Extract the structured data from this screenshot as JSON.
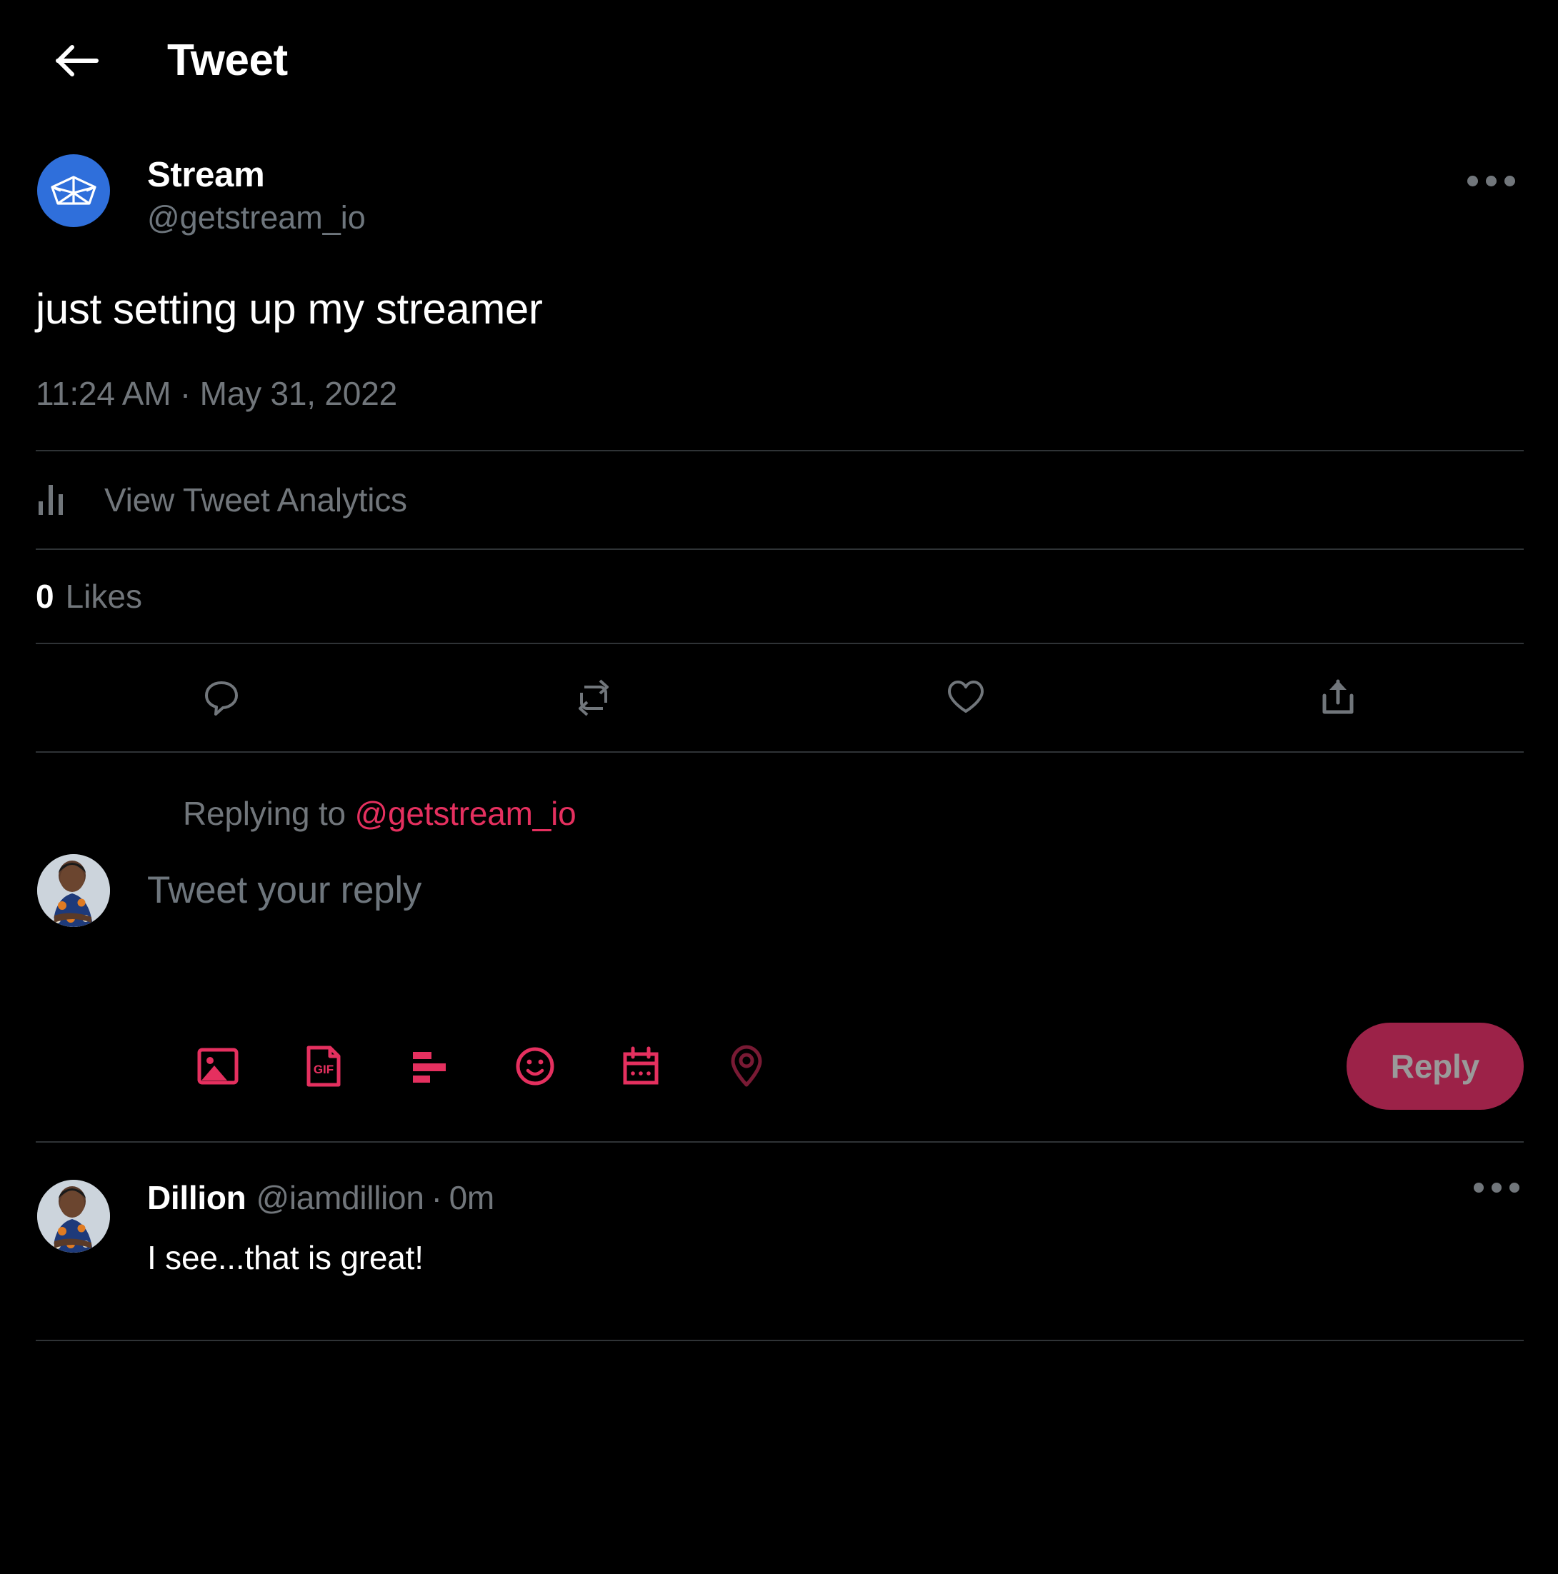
{
  "header": {
    "back_icon": "arrow-left-icon",
    "title": "Tweet"
  },
  "tweet": {
    "author": {
      "display_name": "Stream",
      "handle": "@getstream_io",
      "avatar": "stream-paper-boat-logo",
      "avatar_bg": "#2f6fdb"
    },
    "more_icon": "more-horizontal-icon",
    "text": "just setting up my streamer",
    "timestamp": "11:24 AM · May 31, 2022",
    "analytics": {
      "icon": "bar-chart-icon",
      "label": "View Tweet Analytics"
    },
    "likes": {
      "count": "0",
      "label": "Likes"
    },
    "actions": [
      {
        "name": "reply",
        "icon": "comment-icon"
      },
      {
        "name": "retweet",
        "icon": "retweet-icon"
      },
      {
        "name": "like",
        "icon": "heart-icon"
      },
      {
        "name": "share",
        "icon": "share-upload-icon"
      }
    ]
  },
  "compose": {
    "replying_prefix": "Replying to",
    "replying_mention": "@getstream_io",
    "mention_color": "#e5305f",
    "avatar": "user-photo-avatar",
    "placeholder": "Tweet your reply",
    "value": "",
    "tools": [
      {
        "name": "media",
        "icon": "image-icon"
      },
      {
        "name": "gif",
        "icon": "gif-icon",
        "text": "GIF"
      },
      {
        "name": "poll",
        "icon": "poll-icon"
      },
      {
        "name": "emoji",
        "icon": "emoji-smiley-icon"
      },
      {
        "name": "schedule",
        "icon": "calendar-icon"
      },
      {
        "name": "location",
        "icon": "location-pin-icon"
      }
    ],
    "submit_label": "Reply",
    "submit_bg": "#9c2248",
    "submit_text_color": "#9a9a9a",
    "accent": "#e5305f"
  },
  "replies": [
    {
      "name": "Dillion",
      "handle": "@iamdillion",
      "separator": "·",
      "time": "0m",
      "text": "I see...that is great!",
      "avatar": "user-photo-avatar",
      "more_icon": "more-horizontal-icon"
    }
  ]
}
